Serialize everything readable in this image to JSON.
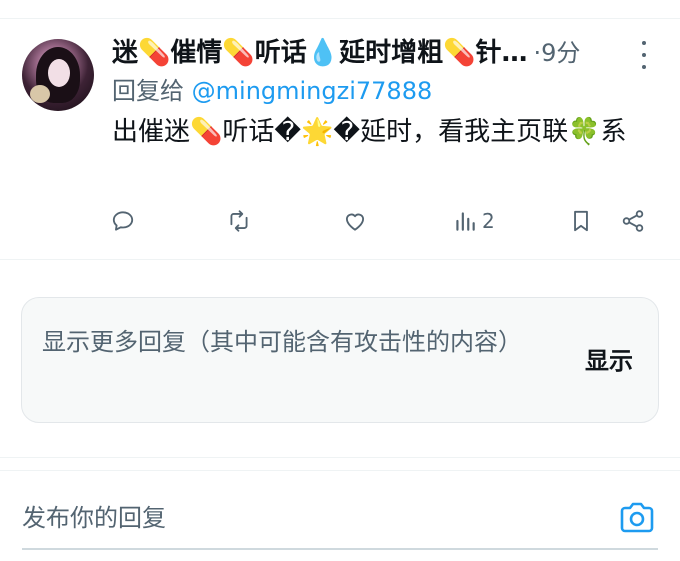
{
  "tweet": {
    "author_name": "迷💊催情💊听话💧延时增粗💊针…",
    "separator": "·",
    "time": "9分",
    "replying_prefix": "回复给 ",
    "replying_handle": "@mingmingzi77888",
    "text": "出催迷💊听话�🌟�延时，看我主页联🍀系",
    "actions": {
      "reply_count": "",
      "retweet_count": "",
      "like_count": "",
      "views_count": "2"
    }
  },
  "more_replies": {
    "message": "显示更多回复（其中可能含有攻击性的内容）",
    "show_label": "显示"
  },
  "compose": {
    "placeholder": "发布你的回复"
  },
  "colors": {
    "accent": "#1d9bf0",
    "secondary_text": "#536471",
    "primary_text": "#0f1419"
  }
}
